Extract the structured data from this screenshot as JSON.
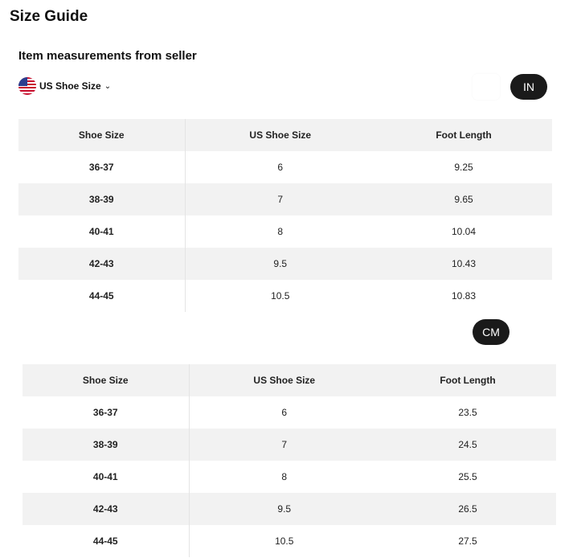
{
  "page_title": "Size Guide",
  "section_title": "Item measurements from seller",
  "size_system": {
    "label": "US Shoe Size",
    "flag_icon": "us-flag-icon"
  },
  "units": {
    "inches": "IN",
    "centimeters": "CM"
  },
  "tables": [
    {
      "unit": "IN",
      "headers": [
        "Shoe Size",
        "US Shoe Size",
        "Foot Length"
      ],
      "rows": [
        [
          "36-37",
          "6",
          "9.25"
        ],
        [
          "38-39",
          "7",
          "9.65"
        ],
        [
          "40-41",
          "8",
          "10.04"
        ],
        [
          "42-43",
          "9.5",
          "10.43"
        ],
        [
          "44-45",
          "10.5",
          "10.83"
        ]
      ]
    },
    {
      "unit": "CM",
      "headers": [
        "Shoe Size",
        "US Shoe Size",
        "Foot Length"
      ],
      "rows": [
        [
          "36-37",
          "6",
          "23.5"
        ],
        [
          "38-39",
          "7",
          "24.5"
        ],
        [
          "40-41",
          "8",
          "25.5"
        ],
        [
          "42-43",
          "9.5",
          "26.5"
        ],
        [
          "44-45",
          "10.5",
          "27.5"
        ]
      ]
    }
  ],
  "colors": {
    "pill_bg": "#1a1a1a",
    "row_stripe": "#f2f2f2"
  }
}
